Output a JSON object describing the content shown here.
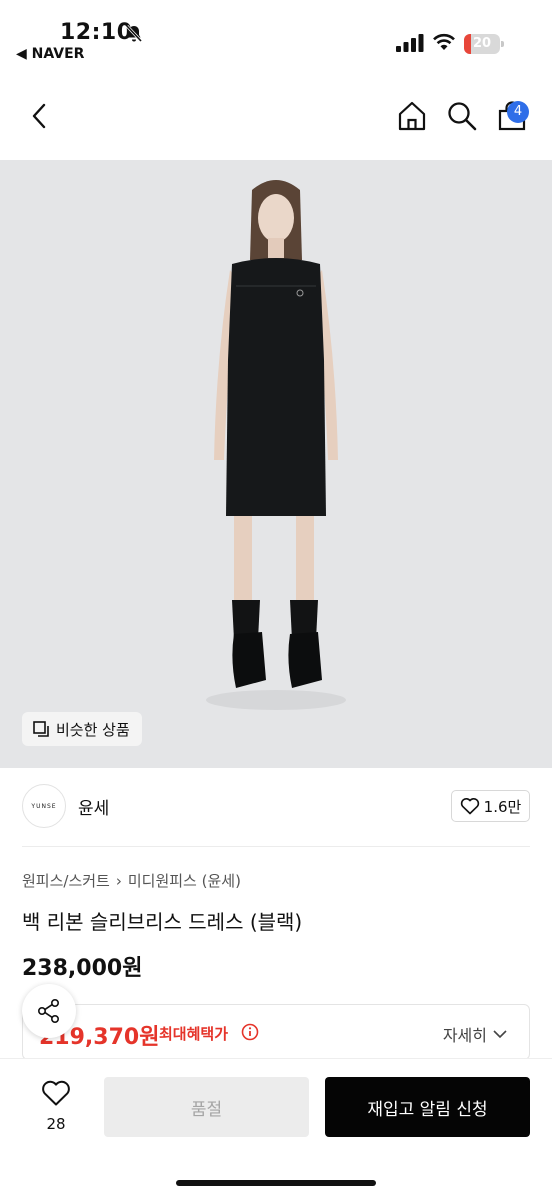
{
  "status_bar": {
    "time": "12:10",
    "back_app": "◀ NAVER",
    "battery": "20",
    "battery_level": 0.2,
    "battery_color": "#e8463a"
  },
  "header": {
    "cart_count": "4",
    "badge_color": "#2f6ee8"
  },
  "image": {
    "similar_label": "비슷한 상품"
  },
  "brand": {
    "logo_text": "YUNSE",
    "name": "윤세",
    "likes": "1.6만"
  },
  "product": {
    "breadcrumb": [
      "원피스/스커트",
      "미디원피스 (윤세)"
    ],
    "title": "백 리본 슬리브리스 드레스 (블랙)",
    "price": "238,000원"
  },
  "benefit": {
    "price": "219,370원",
    "label": "최대혜택가",
    "detail": "자세히",
    "accent": "#e5342a"
  },
  "bottom": {
    "wish_count": "28",
    "soldout": "품절",
    "restock": "재입고 알림 신청"
  }
}
